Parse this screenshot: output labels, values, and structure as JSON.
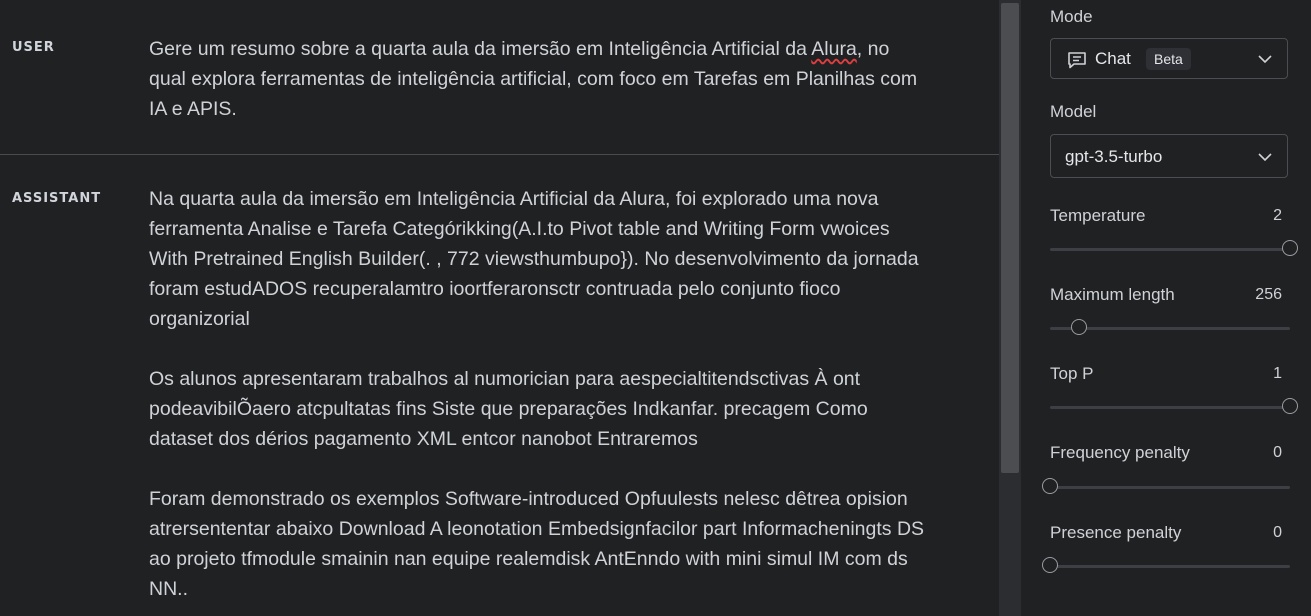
{
  "conversation": {
    "user": {
      "role_label": "USER",
      "text_before": "Gere um resumo sobre a quarta aula da imersão em Inteligência Artificial da ",
      "text_flagged": "Alura",
      "text_after": ", no qual explora ferramentas de inteligência artificial, com foco em Tarefas em Planilhas com IA e APIS."
    },
    "assistant": {
      "role_label": "ASSISTANT",
      "paragraphs": [
        "Na quarta aula da imersão em Inteligência Artificial da Alura, foi explorado uma nova ferramenta Analise e Tarefa Categórikking(A.I.to Pivot table and Writing Form vwoices With Pretrained English Builder(. , 772 viewsthumbupo}). No desenvolvimento da jornada foram estudADOS recuperalamtro ioortferaronsctr contruada pelo conjunto fioco organizorial",
        "Os alunos apresentaram trabalhos al numorician para aespecialtitendsctivas À ont podeavibilÕaero atcpultatas fins Siste que preparações Indkanfar. precagem Como dataset dos dérios pagamento XML entcor nanobot Entraremos",
        "Foram demonstrado os exemplos Software-introduced Opfuulests nelesc dêtrea opision atrersententar abaixo Download A leonotation Embedsignfacilor part Informacheningts DS ao projeto tfmodule smainin nan equipe realemdisk AntEnndo with mini simul IM com ds NN.."
      ]
    }
  },
  "settings": {
    "mode": {
      "label": "Mode",
      "value": "Chat",
      "badge": "Beta",
      "icon": "chat-bubble-icon"
    },
    "model": {
      "label": "Model",
      "value": "gpt-3.5-turbo"
    },
    "sliders": [
      {
        "label": "Temperature",
        "value": "2",
        "fraction": 1.0
      },
      {
        "label": "Maximum length",
        "value": "256",
        "fraction": 0.12
      },
      {
        "label": "Top P",
        "value": "1",
        "fraction": 1.0
      },
      {
        "label": "Frequency penalty",
        "value": "0",
        "fraction": 0.0
      },
      {
        "label": "Presence penalty",
        "value": "0",
        "fraction": 0.0
      }
    ]
  },
  "colors": {
    "background": "#202123",
    "text": "#cfd2d6",
    "spellcheck": "#e03e3e"
  }
}
